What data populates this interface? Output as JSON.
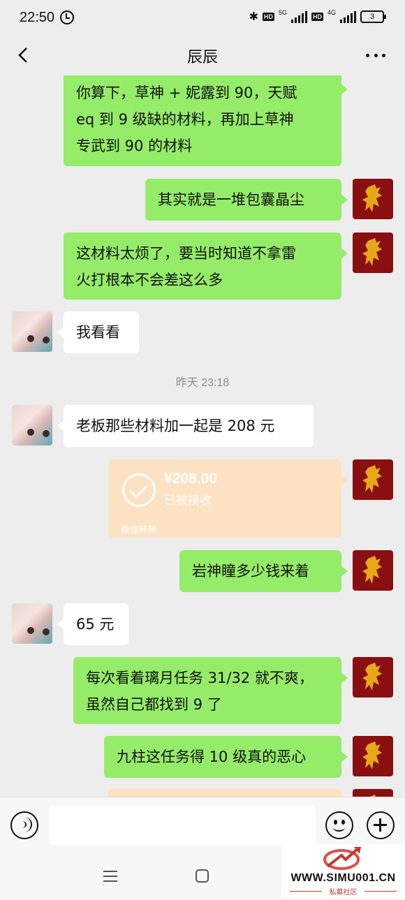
{
  "status_bar": {
    "time": "22:50",
    "network_1": "5G",
    "network_2": "4G",
    "hd": "HD",
    "battery": "3"
  },
  "header": {
    "title": "辰辰"
  },
  "messages": [
    {
      "side": "right",
      "type": "text",
      "text_lines": [
        "你算下，草神 + 妮露到 90，天赋",
        "eq 到 9 级缺的材料，再加上草神",
        "专武到 90 的材料"
      ]
    },
    {
      "side": "right",
      "type": "text",
      "text_lines": [
        "其实就是一堆包囊晶尘"
      ]
    },
    {
      "side": "right",
      "type": "text",
      "text_lines": [
        "这材料太烦了，要当时知道不拿雷",
        "火打根本不会差这么多"
      ]
    },
    {
      "side": "left",
      "type": "text",
      "text_lines": [
        "我看看"
      ]
    },
    {
      "type": "timestamp",
      "text": "昨天 23:18"
    },
    {
      "side": "left",
      "type": "text",
      "text_lines": [
        "老板那些材料加一起是 208 元"
      ]
    },
    {
      "side": "right",
      "type": "transfer",
      "amount": "¥208.00",
      "status": "已被接收",
      "source": "微信转账"
    },
    {
      "side": "right",
      "type": "text",
      "text_lines": [
        "岩神瞳多少钱来着"
      ]
    },
    {
      "side": "left",
      "type": "text",
      "text_lines": [
        "65 元"
      ]
    },
    {
      "side": "right",
      "type": "text",
      "text_lines": [
        "每次看着璃月任务 31/32 就不爽，",
        "虽然自己都找到 9 了"
      ]
    },
    {
      "side": "right",
      "type": "text",
      "text_lines": [
        "九柱这任务得 10 级真的恶心"
      ]
    }
  ],
  "input_bar": {
    "placeholder": ""
  },
  "watermark": {
    "text": "WWW.SIMU001.CN",
    "subtext": "私募社区"
  },
  "colors": {
    "self_bubble": "#95ec69",
    "other_bubble": "#ffffff",
    "transfer_card": "#fde1c3",
    "background": "#ededed",
    "avatar_red": "#8a0f10"
  }
}
